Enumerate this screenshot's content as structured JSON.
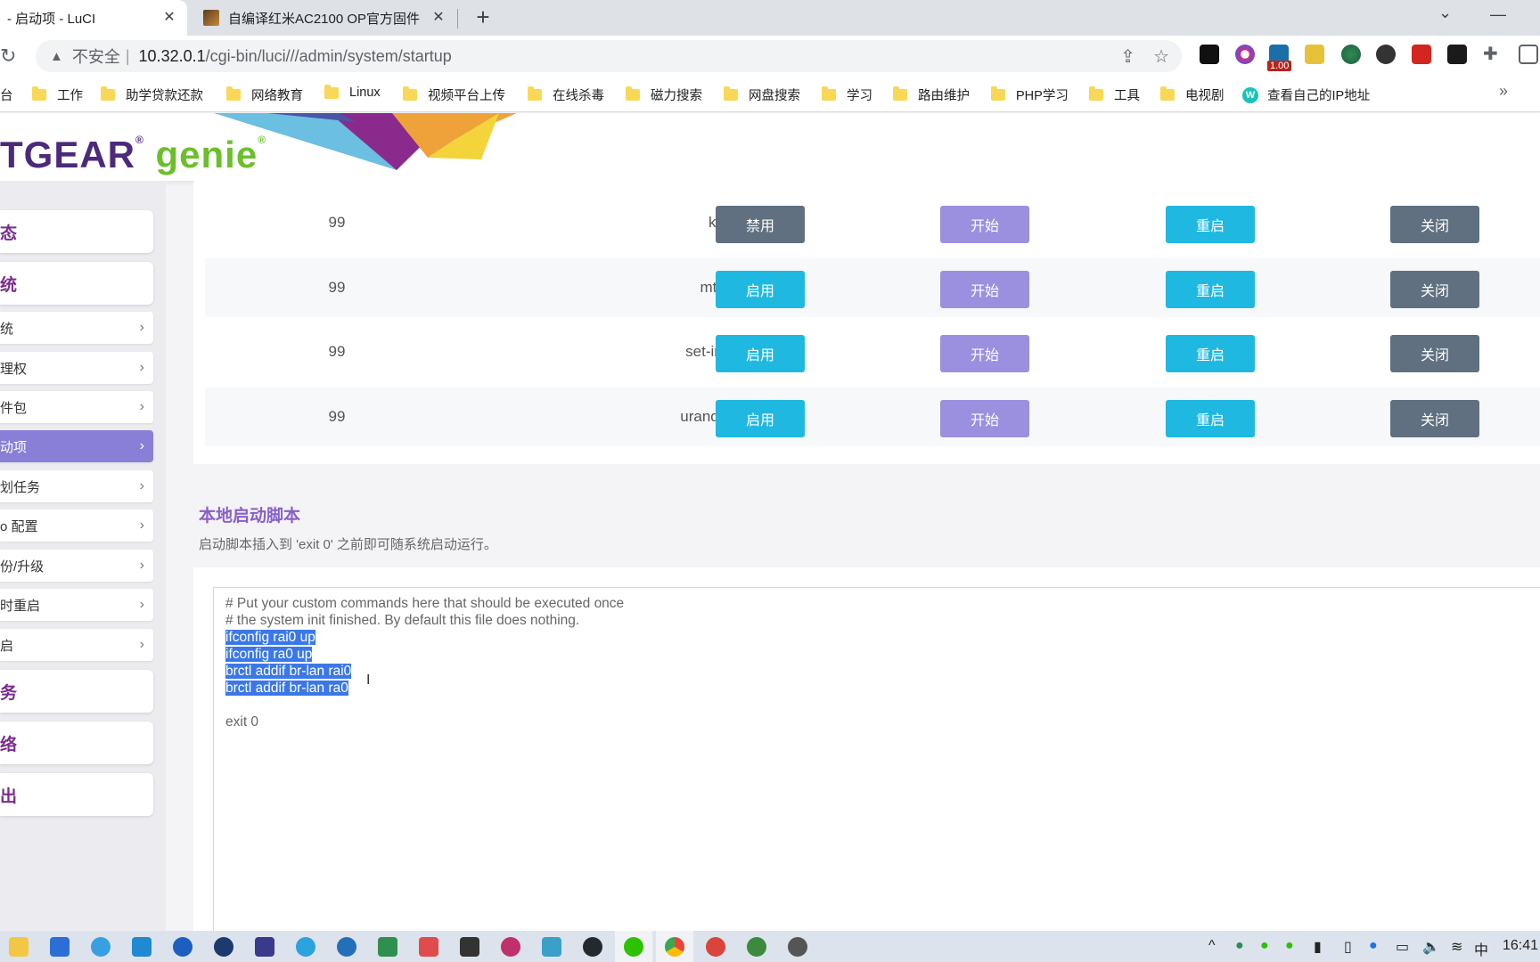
{
  "browser": {
    "tabs": [
      {
        "title": "- 启动项 - LuCI",
        "active": true
      },
      {
        "title": "自编译红米AC2100 OP官方固件",
        "active": false
      }
    ],
    "close_glyph": "✕",
    "new_tab_glyph": "+",
    "minimize_glyph": "—",
    "dropdown_glyph": "⌄",
    "reload_glyph": "↻",
    "insecure_label": "不安全",
    "url_host": "10.32.0.1",
    "url_path": "/cgi-bin/luci///admin/system/startup",
    "extension_badge": "1.00",
    "bookmarks": [
      "台",
      "工作",
      "助学贷款还款",
      "网络教育",
      "Linux",
      "视频平台上传",
      "在线杀毒",
      "磁力搜索",
      "网盘搜索",
      "学习",
      "路由维护",
      "PHP学习",
      "工具",
      "电视剧",
      "查看自己的IP地址"
    ],
    "bookmark_more": "»"
  },
  "logo": {
    "brand": "TGEAR",
    "product": "genie",
    "reg": "®"
  },
  "sidebar": {
    "main_items": [
      {
        "label": "态"
      },
      {
        "label": "统"
      },
      {
        "label": "务"
      },
      {
        "label": "络"
      },
      {
        "label": "出"
      }
    ],
    "sub_items": [
      {
        "label": "统",
        "active": false
      },
      {
        "label": "理权",
        "active": false
      },
      {
        "label": "件包",
        "active": false
      },
      {
        "label": "动项",
        "active": true
      },
      {
        "label": "划任务",
        "active": false
      },
      {
        "label": "o 配置",
        "active": false
      },
      {
        "label": "份/升级",
        "active": false
      },
      {
        "label": "时重启",
        "active": false
      },
      {
        "label": "启",
        "active": false
      }
    ],
    "chevron": "›"
  },
  "startup_table": {
    "rows": [
      {
        "priority": "99",
        "name": "kcptun",
        "toggle": "禁用",
        "toggle_state": "enabled",
        "start": "开始",
        "restart": "重启",
        "stop": "关闭"
      },
      {
        "priority": "99",
        "name": "mtkiappd",
        "toggle": "启用",
        "toggle_state": "disabled",
        "start": "开始",
        "restart": "重启",
        "stop": "关闭"
      },
      {
        "priority": "99",
        "name": "set-irq-affinity",
        "toggle": "启用",
        "toggle_state": "disabled",
        "start": "开始",
        "restart": "重启",
        "stop": "关闭"
      },
      {
        "priority": "99",
        "name": "urandom_seed",
        "toggle": "启用",
        "toggle_state": "disabled",
        "start": "开始",
        "restart": "重启",
        "stop": "关闭"
      }
    ]
  },
  "local_startup": {
    "title": "本地启动脚本",
    "description": "启动脚本插入到 'exit 0' 之前即可随系统启动运行。",
    "lines": [
      {
        "text": "# Put your custom commands here that should be executed once",
        "selected": false
      },
      {
        "text": "# the system init finished. By default this file does nothing.",
        "selected": false
      },
      {
        "text": "ifconfig rai0 up",
        "selected": true
      },
      {
        "text": "ifconfig ra0 up",
        "selected": true
      },
      {
        "text": "brctl addif br-lan rai0",
        "selected": true
      },
      {
        "text": "brctl addif br-lan ra0",
        "selected": true
      },
      {
        "text": "",
        "selected": false
      },
      {
        "text": "exit 0",
        "selected": false
      }
    ]
  },
  "taskbar": {
    "ime": "中",
    "clock": "16:41"
  },
  "colors": {
    "accent_purple": "#8a7fd6",
    "btn_disable": "#607080",
    "btn_enable": "#1fb8e0",
    "btn_start": "#9b8fe0",
    "btn_restart": "#1fb8e0",
    "btn_stop": "#607080",
    "selection": "#3b78e7"
  }
}
